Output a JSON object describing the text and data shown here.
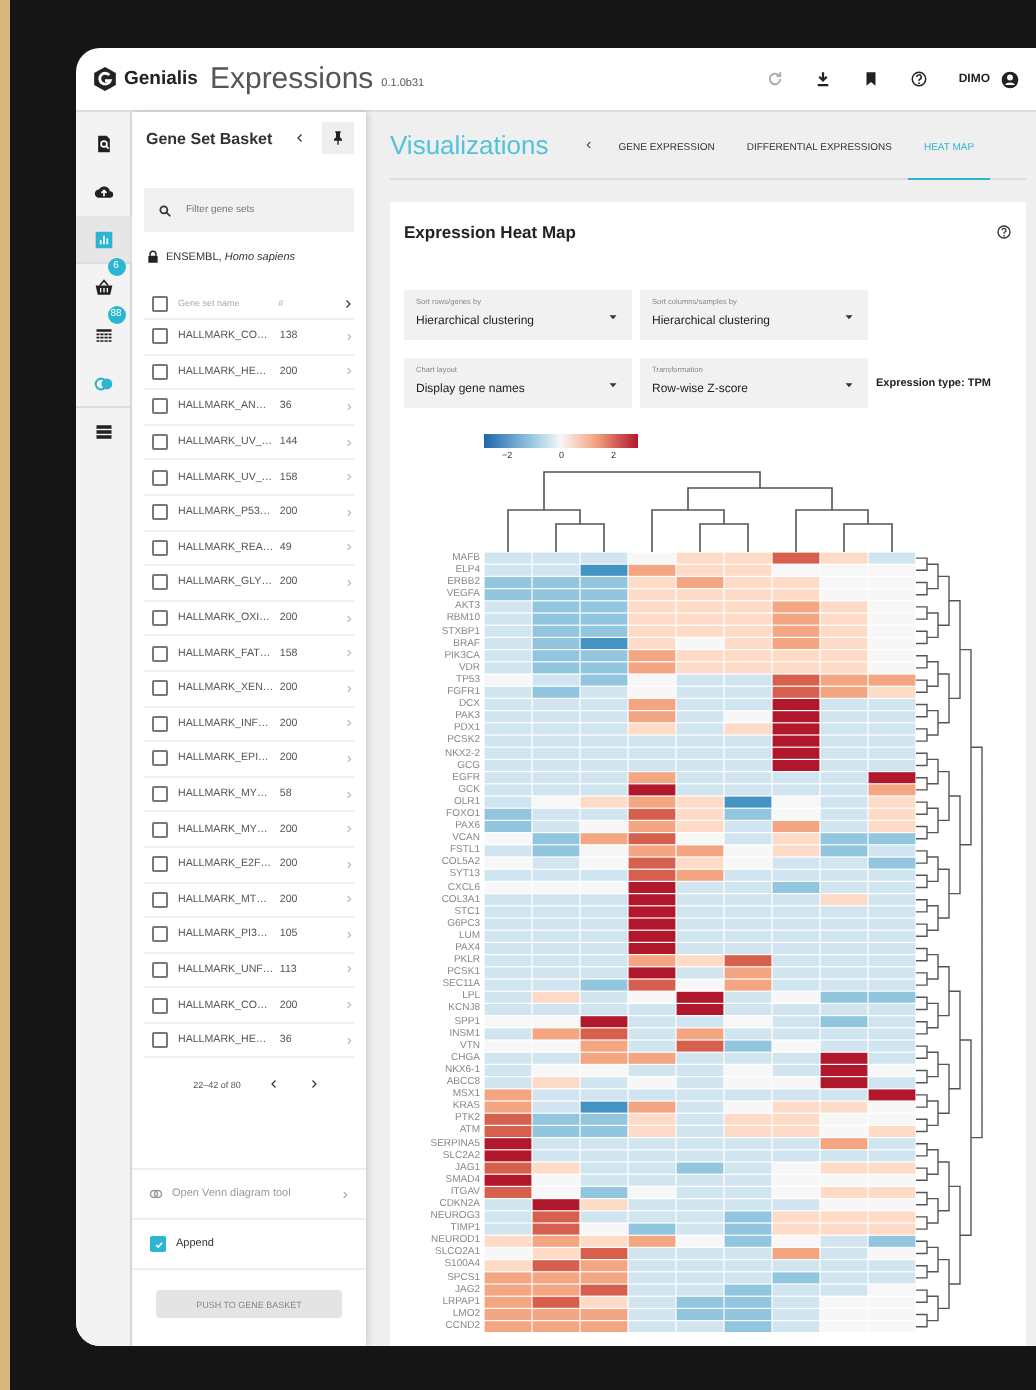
{
  "header": {
    "brand": "Genialis",
    "app": "Expressions",
    "version": "0.1.0b31",
    "user": "DIMO"
  },
  "rail": [
    {
      "kind": "search",
      "selected": false
    },
    {
      "kind": "upload",
      "selected": false
    },
    {
      "kind": "chart",
      "selected": true
    },
    {
      "kind": "basket",
      "selected": false,
      "badge": "6"
    },
    {
      "kind": "table",
      "selected": false,
      "badge": "88"
    },
    {
      "kind": "venn",
      "selected": false
    },
    {
      "kind": "list",
      "selected": false
    }
  ],
  "basket": {
    "title": "Gene Set Basket",
    "filter_placeholder": "Filter gene sets",
    "source": "ENSEMBL, *Homo sapiens*",
    "columns": [
      "Gene set name",
      "#"
    ],
    "select_all": {
      "checked": false
    },
    "rows": [
      {
        "name": "HALLMARK_CO…",
        "count": "138",
        "checked": false
      },
      {
        "name": "HALLMARK_HE…",
        "count": "200",
        "checked": false
      },
      {
        "name": "HALLMARK_AN…",
        "count": "36",
        "checked": false
      },
      {
        "name": "HALLMARK_UV_…",
        "count": "144",
        "checked": false
      },
      {
        "name": "HALLMARK_UV_…",
        "count": "158",
        "checked": false
      },
      {
        "name": "HALLMARK_P53…",
        "count": "200",
        "checked": false
      },
      {
        "name": "HALLMARK_REA…",
        "count": "49",
        "checked": false
      },
      {
        "name": "HALLMARK_GLY…",
        "count": "200",
        "checked": false
      },
      {
        "name": "HALLMARK_OXI…",
        "count": "200",
        "checked": false
      },
      {
        "name": "HALLMARK_FAT…",
        "count": "158",
        "checked": false
      },
      {
        "name": "HALLMARK_XEN…",
        "count": "200",
        "checked": false
      },
      {
        "name": "HALLMARK_INF…",
        "count": "200",
        "checked": false
      },
      {
        "name": "HALLMARK_EPI…",
        "count": "200",
        "checked": false
      },
      {
        "name": "HALLMARK_MY…",
        "count": "58",
        "checked": false
      },
      {
        "name": "HALLMARK_MY…",
        "count": "200",
        "checked": false
      },
      {
        "name": "HALLMARK_E2F…",
        "count": "200",
        "checked": false
      },
      {
        "name": "HALLMARK_MT…",
        "count": "200",
        "checked": false
      },
      {
        "name": "HALLMARK_PI3…",
        "count": "105",
        "checked": false
      },
      {
        "name": "HALLMARK_UNF…",
        "count": "113",
        "checked": false
      },
      {
        "name": "HALLMARK_CO…",
        "count": "200",
        "checked": false
      },
      {
        "name": "HALLMARK_HE…",
        "count": "36",
        "checked": false
      }
    ],
    "pagination": "22–42 of 80",
    "venn": "Open Venn diagram tool",
    "append": {
      "label": "Append",
      "checked": true
    },
    "push_button": {
      "label": "PUSH TO GENE BASKET",
      "disabled": true
    }
  },
  "visualizations": {
    "title": "Visualizations",
    "tabs": [
      {
        "label": "GENE EXPRESSION",
        "selected": false
      },
      {
        "label": "DIFFERENTIAL EXPRESSIONS",
        "selected": false
      },
      {
        "label": "HEAT MAP",
        "selected": true
      }
    ]
  },
  "heatmap": {
    "title": "Expression Heat Map",
    "controls": [
      {
        "label": "Sort rows/genes by",
        "value": "Hierarchical clustering"
      },
      {
        "label": "Sort columns/samples by",
        "value": "Hierarchical clustering"
      },
      {
        "label": "Chart layout",
        "value": "Display gene names"
      },
      {
        "label": "Transformation",
        "value": "Row-wise Z-score"
      }
    ],
    "expression_type": "Expression type: TPM",
    "legend_ticks": [
      "−2",
      "0",
      "2"
    ],
    "genes": [
      "MAFB",
      "ELP4",
      "ERBB2",
      "VEGFA",
      "AKT3",
      "RBM10",
      "STXBP1",
      "BRAF",
      "PIK3CA",
      "VDR",
      "TP53",
      "FGFR1",
      "DCX",
      "PAK3",
      "PDX1",
      "PCSK2",
      "NKX2-2",
      "GCG",
      "EGFR",
      "GCK",
      "OLR1",
      "FOXO1",
      "PAX6",
      "VCAN",
      "FSTL1",
      "COL5A2",
      "SYT13",
      "CXCL6",
      "COL3A1",
      "STC1",
      "G6PC3",
      "LUM",
      "PAX4",
      "PKLR",
      "PCSK1",
      "SEC11A",
      "LPL",
      "KCNJ8",
      "SPP1",
      "INSM1",
      "VTN",
      "CHGA",
      "NKX6-1",
      "ABCC8",
      "MSX1",
      "KRAS",
      "PTK2",
      "ATM",
      "SERPINA5",
      "SLC2A2",
      "JAG1",
      "SMAD4",
      "ITGAV",
      "CDKN2A",
      "NEUROG3",
      "TIMP1",
      "NEUROD1",
      "SLCO2A1",
      "S100A4",
      "SPCS1",
      "JAG2",
      "LRPAP1",
      "LMO2",
      "CCND2"
    ]
  }
}
